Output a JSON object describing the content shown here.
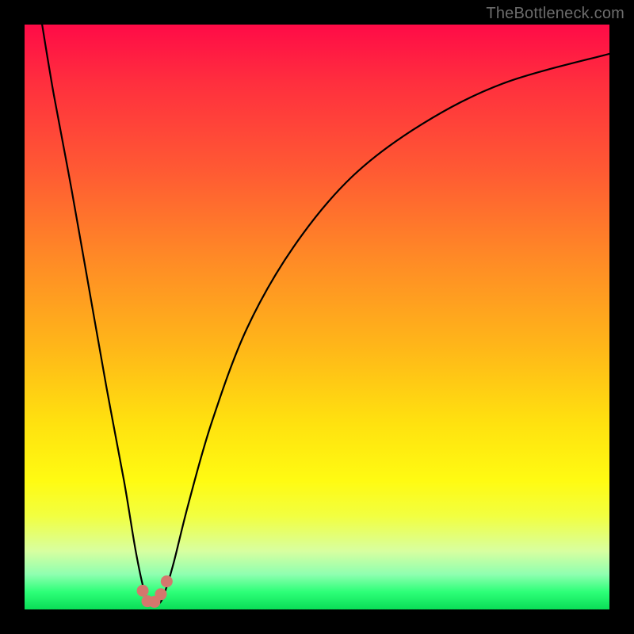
{
  "watermark": {
    "text": "TheBottleneck.com"
  },
  "gradient": {
    "top": "#ff0b47",
    "mid_orange": "#ff8a26",
    "mid_yellow": "#ffe10f",
    "bottom": "#0ade57"
  },
  "chart_data": {
    "type": "line",
    "title": "",
    "xlabel": "",
    "ylabel": "",
    "xlim": [
      0,
      100
    ],
    "ylim": [
      0,
      100
    ],
    "grid": false,
    "notes": "No axes or tick labels visible. Y measures bottleneck percentage implied by color gradient (red high, green low). X is some hardware/performance axis. Curve touches 0 at the optimal x and rises on both sides.",
    "series": [
      {
        "name": "bottleneck-curve",
        "stroke": "#000000",
        "x": [
          3,
          5,
          8,
          11,
          14,
          17,
          19,
          20.5,
          21.5,
          23,
          24,
          25.5,
          28,
          32,
          38,
          46,
          56,
          68,
          82,
          100
        ],
        "values": [
          100,
          88,
          72,
          55,
          38,
          22,
          10,
          3,
          1,
          1,
          3,
          8,
          18,
          32,
          48,
          62,
          74,
          83,
          90,
          95
        ]
      }
    ],
    "marker_cluster": {
      "comment": "Salmon-colored dots near curve minimum",
      "color": "#d4776d",
      "points": [
        {
          "x": 20.2,
          "y": 3.2
        },
        {
          "x": 21.0,
          "y": 1.4
        },
        {
          "x": 22.2,
          "y": 1.3
        },
        {
          "x": 23.3,
          "y": 2.6
        },
        {
          "x": 24.3,
          "y": 4.8
        }
      ]
    }
  }
}
